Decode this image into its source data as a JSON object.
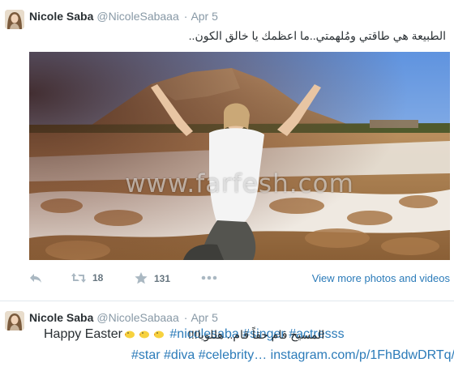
{
  "tweets": [
    {
      "name": "Nicole Saba",
      "handle": "@NicoleSabaaa",
      "separator": "·",
      "date": "Apr 5",
      "text": "الطبيعة هي طاقتي ومُلهمتي..ما اعظمك يا خالق الكون..",
      "photo": {
        "watermark": "www.farfesh.com"
      },
      "actions": {
        "reply_icon": "reply-icon",
        "retweet_icon": "retweet-icon",
        "retweet_count": "18",
        "favorite_icon": "star-icon",
        "favorite_count": "131",
        "more_icon": "more-dots-icon"
      },
      "view_more": "View more photos and videos"
    },
    {
      "name": "Nicole Saba",
      "handle": "@NicoleSabaaa",
      "separator": "·",
      "date": "Apr 5",
      "text_rtl": "المسيح قام حقاً قام.. هللويا!!!",
      "text_ltr": "Happy Easter",
      "emoji": "chick-emoji",
      "hashtags_line1": [
        "#nicolesaba",
        "#singer",
        "#actresss"
      ],
      "hashtags_line2": [
        "#star",
        "#diva",
        "#celebrity…"
      ],
      "link": "instagram.com/p/1FhBdwDRTq/"
    }
  ],
  "colors": {
    "text": "#292f33",
    "muted": "#8899a6",
    "link": "#2b7bb9",
    "action": "#66757f",
    "divider": "#e1e8ed"
  }
}
